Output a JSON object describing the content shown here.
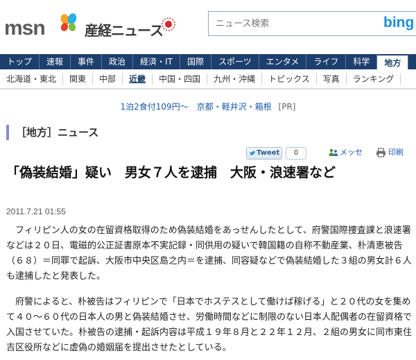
{
  "header": {
    "msn_logo": "msn",
    "sankei_logo": "産経ニュース",
    "search_placeholder": "ニュース検索",
    "bing_logo": "bing",
    "brand_colors": {
      "nav": "#1d3f6e",
      "accent": "#8a8ec8",
      "link": "#1a5aa8"
    }
  },
  "main_nav": [
    {
      "label": "トップ"
    },
    {
      "label": "速報"
    },
    {
      "label": "事件"
    },
    {
      "label": "政治"
    },
    {
      "label": "経済・IT"
    },
    {
      "label": "国際"
    },
    {
      "label": "スポーツ"
    },
    {
      "label": "エンタメ"
    },
    {
      "label": "ライフ"
    },
    {
      "label": "科学"
    },
    {
      "label": "地方"
    }
  ],
  "sub_nav": [
    {
      "label": "北海道・東北"
    },
    {
      "label": "関東"
    },
    {
      "label": "中部"
    },
    {
      "label": "近畿"
    },
    {
      "label": "中国・四国"
    },
    {
      "label": "九州・沖縄"
    },
    {
      "label": "トピックス"
    },
    {
      "label": "写真"
    },
    {
      "label": "ランキング"
    }
  ],
  "ad": {
    "text": "1泊2食付109円～　京都・軽井沢・箱根",
    "pr": "[PR]"
  },
  "section": {
    "title": "［地方］ニュース"
  },
  "share": {
    "tweet_label": "Tweet",
    "tweet_count": "0",
    "mail_label": "メッセ",
    "print_label": "印刷"
  },
  "article": {
    "title": "「偽装結婚」疑い　男女７人を逮捕　大阪・浪速署など",
    "date": "2011.7.21 01:55",
    "paragraphs": [
      "フィリピン人の女の在留資格取得のため偽装結婚をあっせんしたとして、府警国際捜査課と浪速署などは２０日、電磁的公正証書原本不実記録・同供用の疑いで韓国籍の自称不動産業、朴清恵被告（６８）＝同罪で起訴、大阪市中央区島之内＝を逮捕、同容疑などで偽装結婚した３組の男女計６人も逮捕したと発表した。",
      "府警によると、朴被告はフィリピンで「日本でホステスとして働けば稼げる」と２０代の女を集めて４０～６０代の日本人の男と偽装結婚させ、労働時間などに制限のない日本人配偶者の在留資格で入国させていた。朴被告の逮捕・起訴内容は平成１９年８月と２２年１２月、２組の男女に同市東住吉区役所などに虚偽の婚姻届を提出させたとしている。"
    ]
  }
}
